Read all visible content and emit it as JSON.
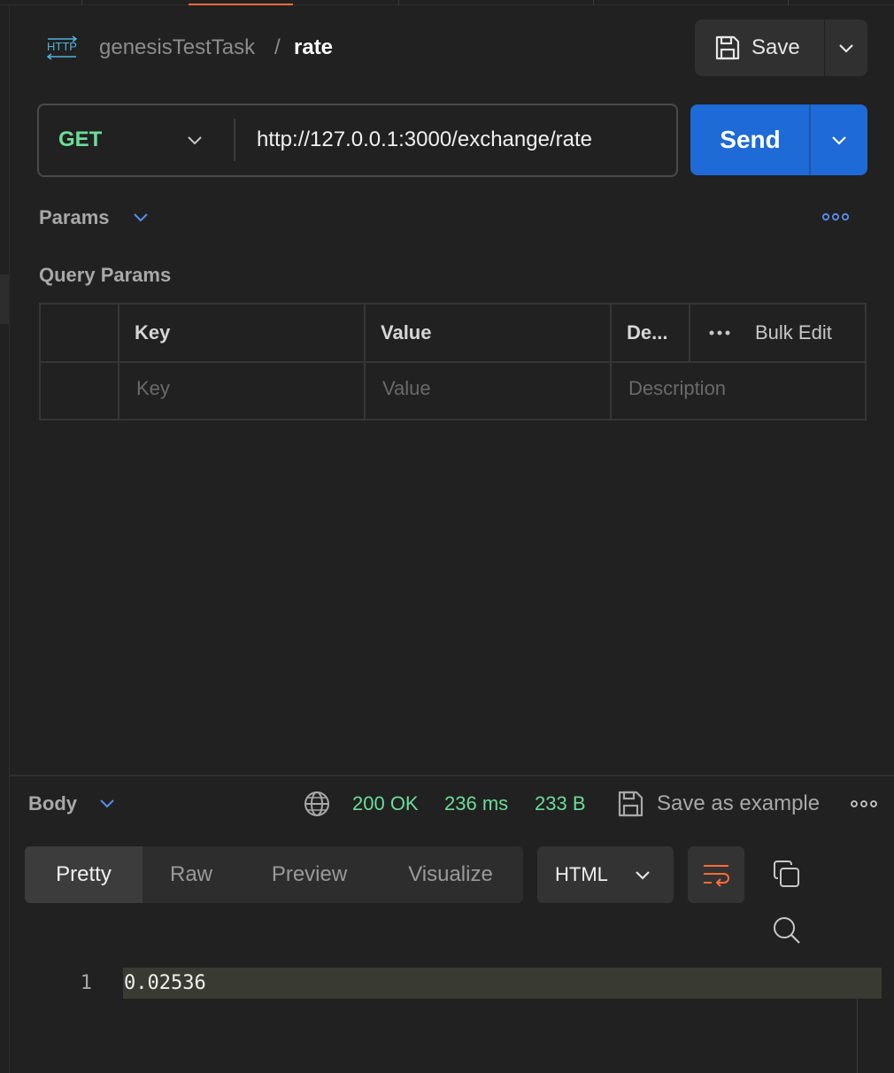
{
  "breadcrumb": {
    "collection": "genesisTestTask",
    "separator": "/",
    "request_name": "rate"
  },
  "icons": {
    "http": "http-request-icon",
    "save": "floppy-disk-icon",
    "chevron": "chevron-down-icon",
    "more": "more-horizontal-icon",
    "globe": "globe-icon",
    "wrap": "wrap-lines-icon",
    "copy": "copy-icon",
    "search": "search-icon"
  },
  "toolbar": {
    "save_label": "Save",
    "send_label": "Send"
  },
  "request": {
    "method": "GET",
    "url": "http://127.0.0.1:3000/exchange/rate"
  },
  "params": {
    "section_label": "Params",
    "query_title": "Query Params",
    "columns": {
      "key": "Key",
      "value": "Value",
      "description": "De...",
      "bulk_edit": "Bulk Edit"
    },
    "placeholders": {
      "key": "Key",
      "value": "Value",
      "description": "Description"
    }
  },
  "response": {
    "section_label": "Body",
    "status": "200 OK",
    "time": "236 ms",
    "size": "233 B",
    "save_example": "Save as example",
    "view_tabs": [
      "Pretty",
      "Raw",
      "Preview",
      "Visualize"
    ],
    "format": "HTML",
    "lines": [
      {
        "number": "1",
        "text": "0.02536"
      }
    ]
  },
  "colors": {
    "accent_orange": "#ff6c37",
    "send_blue": "#1e6ad6",
    "method_green": "#6bdd9a",
    "status_green": "#6bdd9a",
    "more_blue": "#5b8def"
  }
}
